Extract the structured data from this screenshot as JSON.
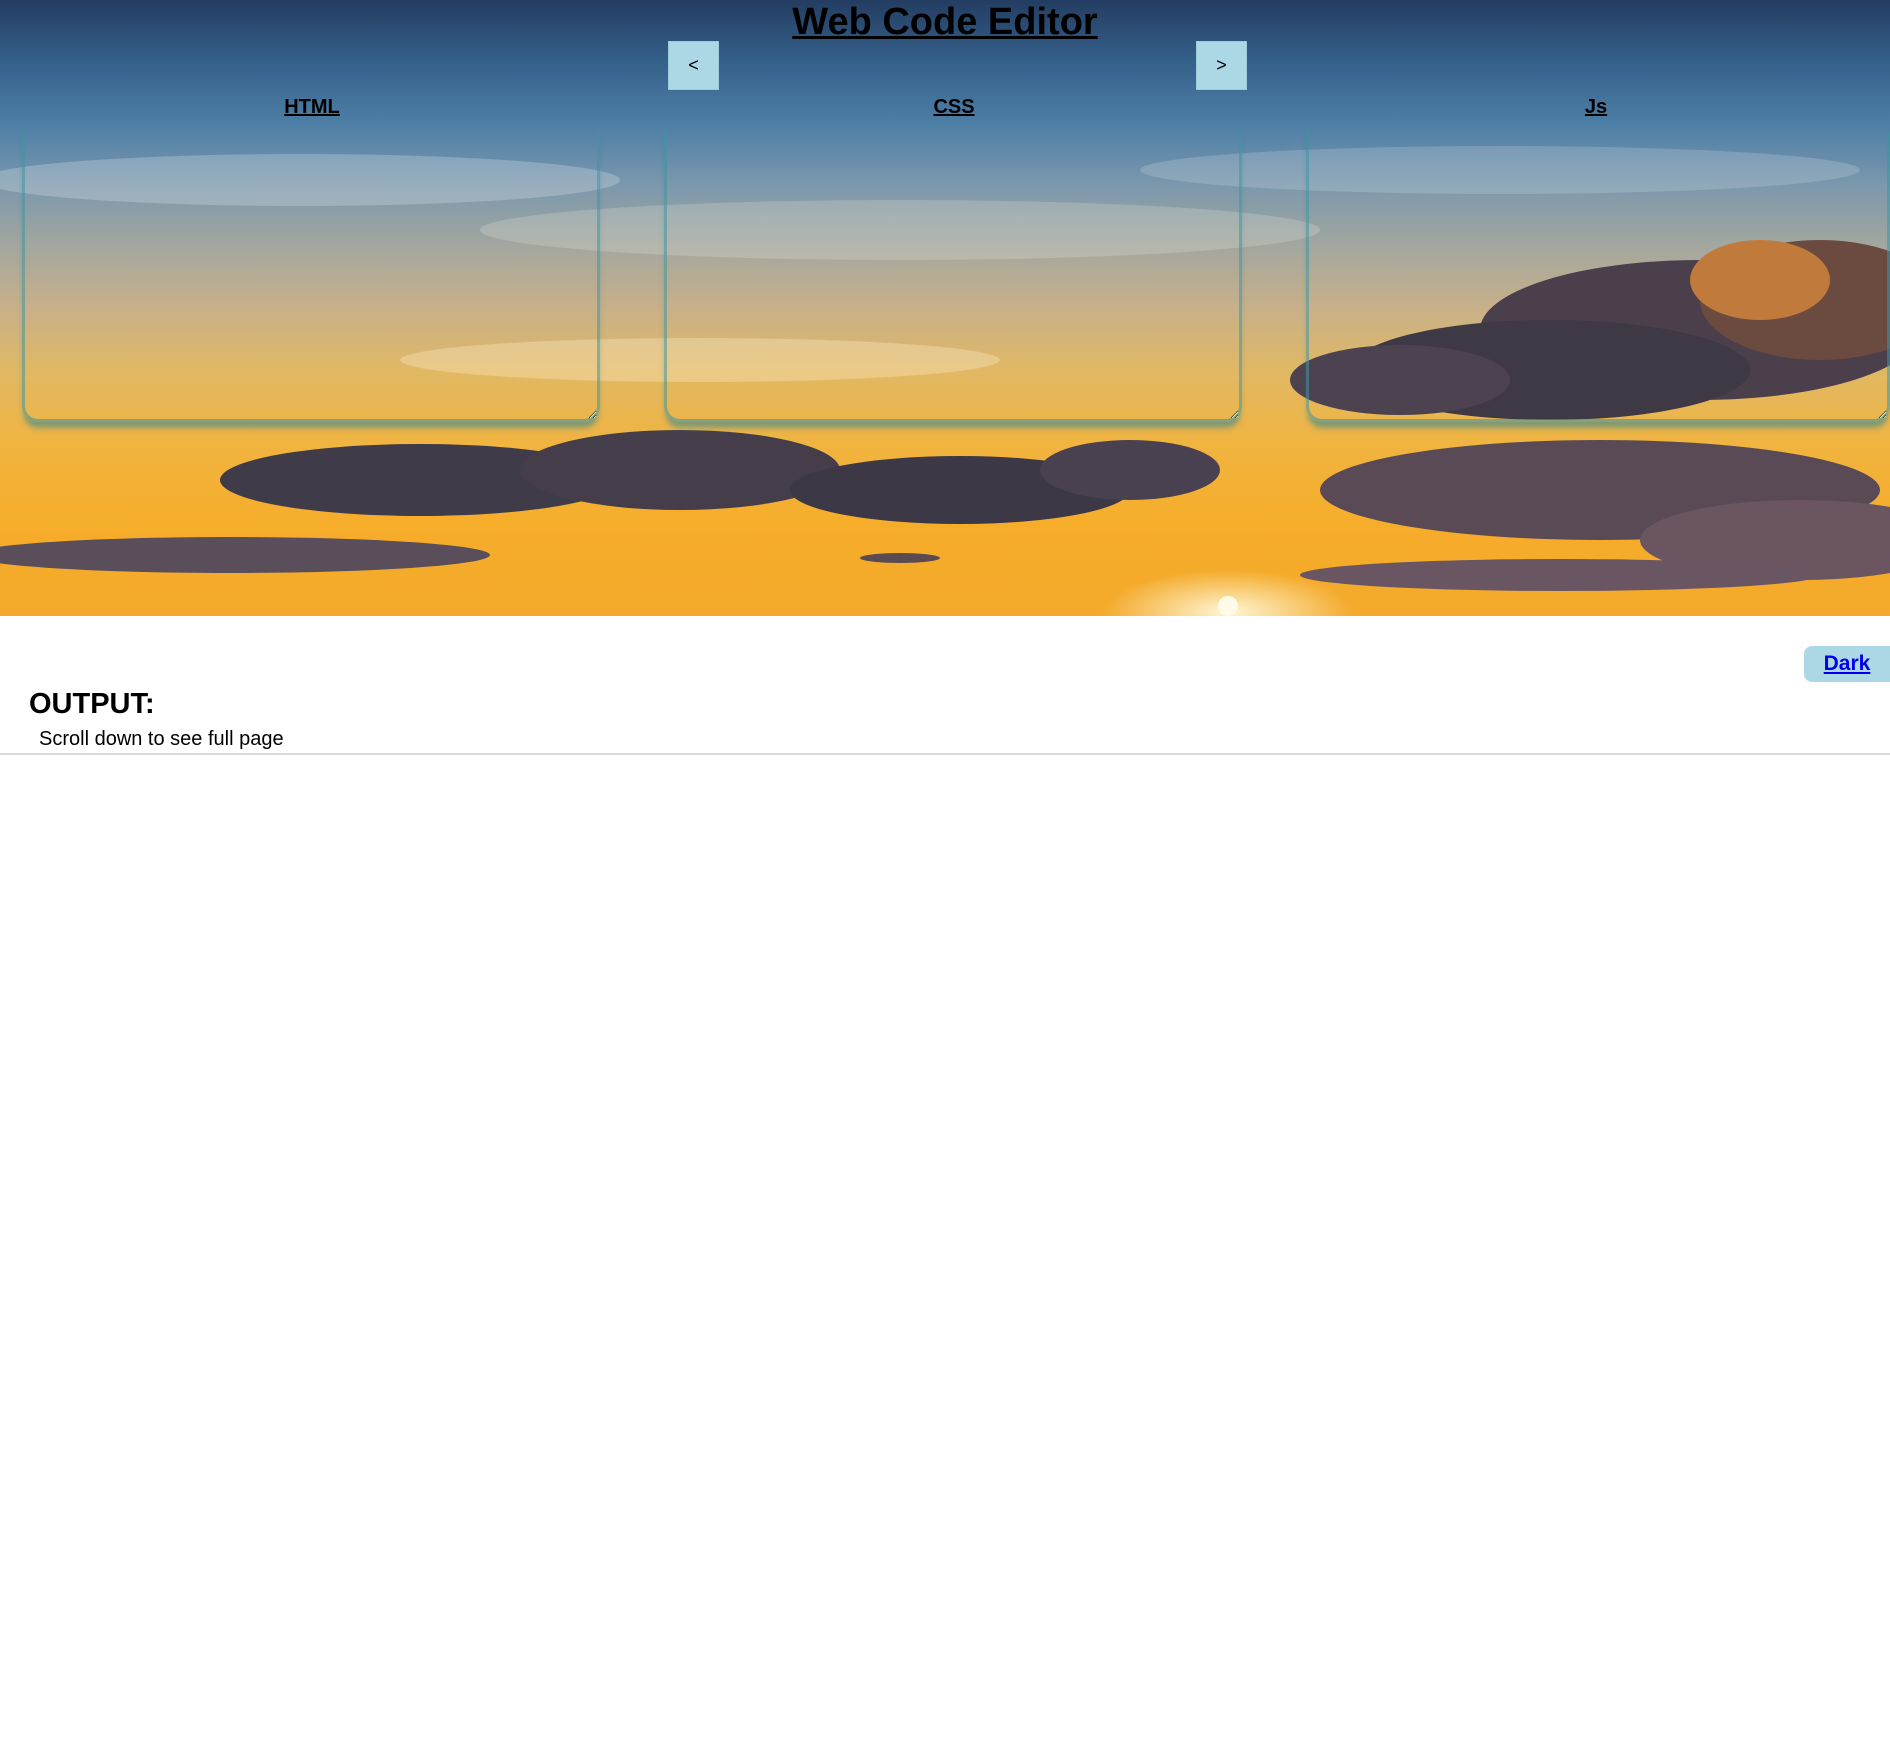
{
  "app": {
    "title": "Web Code Editor"
  },
  "toolbar": {
    "prev_label": "<",
    "next_label": ">"
  },
  "editors": [
    {
      "label": "HTML",
      "value": ""
    },
    {
      "label": "CSS",
      "value": ""
    },
    {
      "label": "Js",
      "value": ""
    }
  ],
  "theme": {
    "toggle_label": "Dark",
    "button_color": "#acd8e6",
    "link_color": "#0000ee",
    "editor_border_color": "#4096a0"
  },
  "output": {
    "heading": "OUTPUT:",
    "hint": "Scroll down to see full page"
  }
}
